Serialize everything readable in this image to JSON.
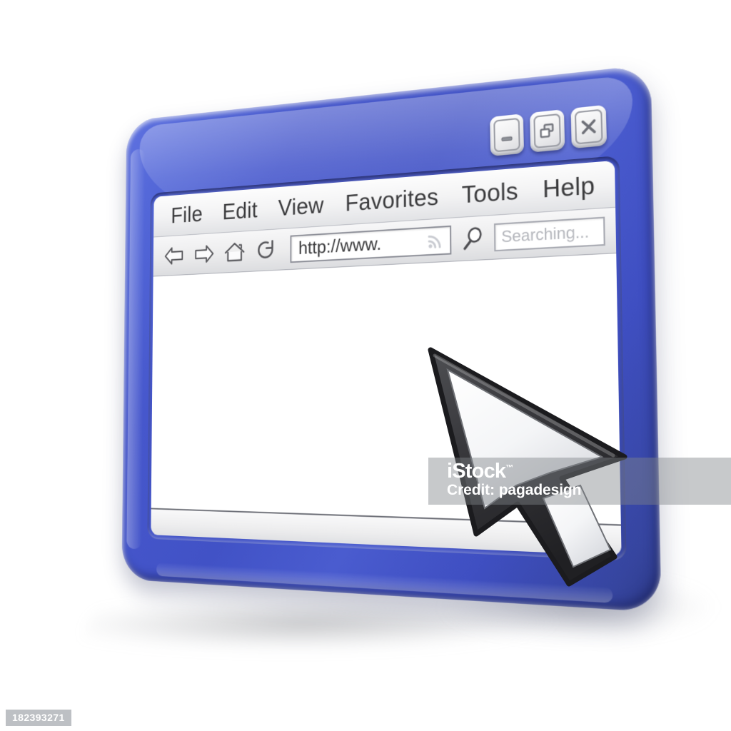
{
  "scene": {
    "background_color": "#ffffff",
    "object": "3d-browser-window-with-cursor"
  },
  "window": {
    "frame_color": "#4657cc",
    "frame_color_dark": "#2e3b88",
    "frame_color_light": "#5f72e0",
    "screen_color": "#ffffff",
    "controls": [
      {
        "name": "minimize",
        "glyph": "minimize-icon",
        "label": "_"
      },
      {
        "name": "restore",
        "glyph": "restore-icon",
        "label": "❐"
      },
      {
        "name": "close",
        "glyph": "close-icon",
        "label": "X"
      }
    ]
  },
  "menubar": {
    "items": [
      {
        "label": "File"
      },
      {
        "label": "Edit"
      },
      {
        "label": "View"
      },
      {
        "label": "Favorites"
      },
      {
        "label": "Tools"
      },
      {
        "label": "Help"
      }
    ]
  },
  "toolbar": {
    "nav_icons": [
      {
        "name": "back-icon",
        "title": "Back"
      },
      {
        "name": "forward-icon",
        "title": "Forward"
      },
      {
        "name": "home-icon",
        "title": "Home"
      },
      {
        "name": "refresh-icon",
        "title": "Refresh"
      }
    ],
    "address": {
      "value": "http://www.",
      "placeholder": "http://www.",
      "feed_icon": "rss-feed-icon"
    },
    "search": {
      "icon": "search-magnifier-icon",
      "value": "",
      "placeholder": "Searching..."
    }
  },
  "statusbar": {
    "text": ""
  },
  "cursor": {
    "name": "mouse-pointer-arrow",
    "fill_color": "#f2f3f5",
    "outline_color": "#3a3a3c"
  },
  "watermark": {
    "logo": "iStock",
    "trademark": "™",
    "credit": "Credit: pagadesign",
    "id": "182393271"
  }
}
